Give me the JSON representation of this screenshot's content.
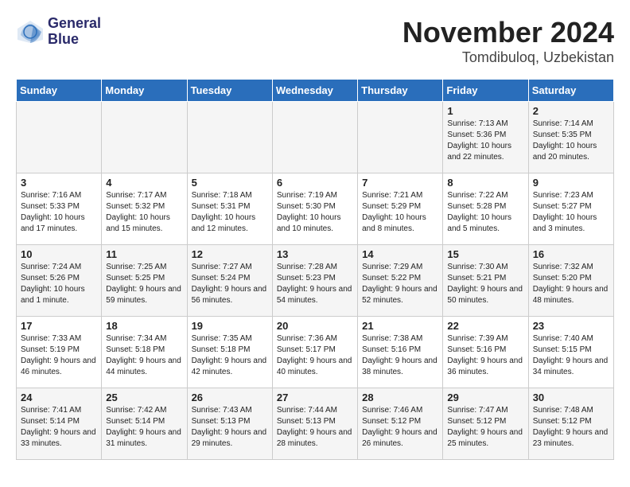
{
  "header": {
    "logo_line1": "General",
    "logo_line2": "Blue",
    "month": "November 2024",
    "location": "Tomdibuloq, Uzbekistan"
  },
  "days_of_week": [
    "Sunday",
    "Monday",
    "Tuesday",
    "Wednesday",
    "Thursday",
    "Friday",
    "Saturday"
  ],
  "weeks": [
    [
      {
        "day": "",
        "info": ""
      },
      {
        "day": "",
        "info": ""
      },
      {
        "day": "",
        "info": ""
      },
      {
        "day": "",
        "info": ""
      },
      {
        "day": "",
        "info": ""
      },
      {
        "day": "1",
        "info": "Sunrise: 7:13 AM\nSunset: 5:36 PM\nDaylight: 10 hours and 22 minutes."
      },
      {
        "day": "2",
        "info": "Sunrise: 7:14 AM\nSunset: 5:35 PM\nDaylight: 10 hours and 20 minutes."
      }
    ],
    [
      {
        "day": "3",
        "info": "Sunrise: 7:16 AM\nSunset: 5:33 PM\nDaylight: 10 hours and 17 minutes."
      },
      {
        "day": "4",
        "info": "Sunrise: 7:17 AM\nSunset: 5:32 PM\nDaylight: 10 hours and 15 minutes."
      },
      {
        "day": "5",
        "info": "Sunrise: 7:18 AM\nSunset: 5:31 PM\nDaylight: 10 hours and 12 minutes."
      },
      {
        "day": "6",
        "info": "Sunrise: 7:19 AM\nSunset: 5:30 PM\nDaylight: 10 hours and 10 minutes."
      },
      {
        "day": "7",
        "info": "Sunrise: 7:21 AM\nSunset: 5:29 PM\nDaylight: 10 hours and 8 minutes."
      },
      {
        "day": "8",
        "info": "Sunrise: 7:22 AM\nSunset: 5:28 PM\nDaylight: 10 hours and 5 minutes."
      },
      {
        "day": "9",
        "info": "Sunrise: 7:23 AM\nSunset: 5:27 PM\nDaylight: 10 hours and 3 minutes."
      }
    ],
    [
      {
        "day": "10",
        "info": "Sunrise: 7:24 AM\nSunset: 5:26 PM\nDaylight: 10 hours and 1 minute."
      },
      {
        "day": "11",
        "info": "Sunrise: 7:25 AM\nSunset: 5:25 PM\nDaylight: 9 hours and 59 minutes."
      },
      {
        "day": "12",
        "info": "Sunrise: 7:27 AM\nSunset: 5:24 PM\nDaylight: 9 hours and 56 minutes."
      },
      {
        "day": "13",
        "info": "Sunrise: 7:28 AM\nSunset: 5:23 PM\nDaylight: 9 hours and 54 minutes."
      },
      {
        "day": "14",
        "info": "Sunrise: 7:29 AM\nSunset: 5:22 PM\nDaylight: 9 hours and 52 minutes."
      },
      {
        "day": "15",
        "info": "Sunrise: 7:30 AM\nSunset: 5:21 PM\nDaylight: 9 hours and 50 minutes."
      },
      {
        "day": "16",
        "info": "Sunrise: 7:32 AM\nSunset: 5:20 PM\nDaylight: 9 hours and 48 minutes."
      }
    ],
    [
      {
        "day": "17",
        "info": "Sunrise: 7:33 AM\nSunset: 5:19 PM\nDaylight: 9 hours and 46 minutes."
      },
      {
        "day": "18",
        "info": "Sunrise: 7:34 AM\nSunset: 5:18 PM\nDaylight: 9 hours and 44 minutes."
      },
      {
        "day": "19",
        "info": "Sunrise: 7:35 AM\nSunset: 5:18 PM\nDaylight: 9 hours and 42 minutes."
      },
      {
        "day": "20",
        "info": "Sunrise: 7:36 AM\nSunset: 5:17 PM\nDaylight: 9 hours and 40 minutes."
      },
      {
        "day": "21",
        "info": "Sunrise: 7:38 AM\nSunset: 5:16 PM\nDaylight: 9 hours and 38 minutes."
      },
      {
        "day": "22",
        "info": "Sunrise: 7:39 AM\nSunset: 5:16 PM\nDaylight: 9 hours and 36 minutes."
      },
      {
        "day": "23",
        "info": "Sunrise: 7:40 AM\nSunset: 5:15 PM\nDaylight: 9 hours and 34 minutes."
      }
    ],
    [
      {
        "day": "24",
        "info": "Sunrise: 7:41 AM\nSunset: 5:14 PM\nDaylight: 9 hours and 33 minutes."
      },
      {
        "day": "25",
        "info": "Sunrise: 7:42 AM\nSunset: 5:14 PM\nDaylight: 9 hours and 31 minutes."
      },
      {
        "day": "26",
        "info": "Sunrise: 7:43 AM\nSunset: 5:13 PM\nDaylight: 9 hours and 29 minutes."
      },
      {
        "day": "27",
        "info": "Sunrise: 7:44 AM\nSunset: 5:13 PM\nDaylight: 9 hours and 28 minutes."
      },
      {
        "day": "28",
        "info": "Sunrise: 7:46 AM\nSunset: 5:12 PM\nDaylight: 9 hours and 26 minutes."
      },
      {
        "day": "29",
        "info": "Sunrise: 7:47 AM\nSunset: 5:12 PM\nDaylight: 9 hours and 25 minutes."
      },
      {
        "day": "30",
        "info": "Sunrise: 7:48 AM\nSunset: 5:12 PM\nDaylight: 9 hours and 23 minutes."
      }
    ]
  ]
}
